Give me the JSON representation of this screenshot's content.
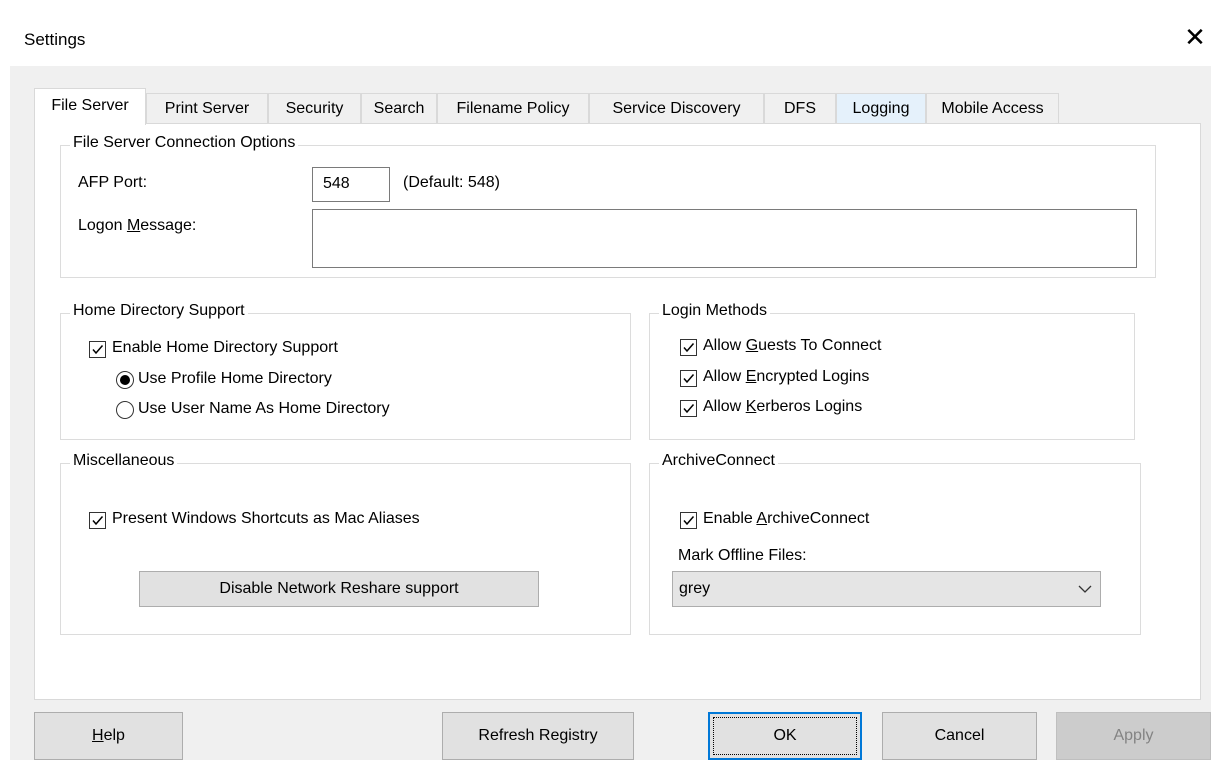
{
  "window": {
    "title": "Settings",
    "close_symbol": "✕"
  },
  "tabs": [
    {
      "label": "File Server",
      "active": true
    },
    {
      "label": "Print Server"
    },
    {
      "label": "Security"
    },
    {
      "label": "Search"
    },
    {
      "label": "Filename Policy"
    },
    {
      "label": "Service Discovery"
    },
    {
      "label": "DFS"
    },
    {
      "label": "Logging",
      "hover": true
    },
    {
      "label": "Mobile Access"
    }
  ],
  "connection": {
    "legend": "File Server Connection Options",
    "afp_port_label": "AFP Port:",
    "afp_port_value": "548",
    "afp_port_default": "(Default: 548)",
    "logon_message_label_pre": "Logon ",
    "logon_message_label_mn": "M",
    "logon_message_label_post": "essage:",
    "logon_message_value": ""
  },
  "home_dir": {
    "legend": "Home Directory Support",
    "enable_label": "Enable Home Directory Support",
    "enable_checked": true,
    "option_profile": "Use Profile Home Directory",
    "option_username": "Use User Name As Home Directory",
    "selected": "profile"
  },
  "login_methods": {
    "legend": "Login Methods",
    "guests_pre": "Allow ",
    "guests_mn": "G",
    "guests_post": "uests To Connect",
    "encrypted_pre": "Allow ",
    "encrypted_mn": "E",
    "encrypted_post": "ncrypted Logins",
    "kerberos_pre": "Allow ",
    "kerberos_mn": "K",
    "kerberos_post": "erberos Logins",
    "guests_checked": true,
    "encrypted_checked": true,
    "kerberos_checked": true
  },
  "misc": {
    "legend": "Miscellaneous",
    "shortcuts_label": "Present Windows Shortcuts as Mac Aliases",
    "shortcuts_checked": true,
    "reshare_button": "Disable Network Reshare support"
  },
  "archive": {
    "legend": "ArchiveConnect",
    "enable_pre": "Enable ",
    "enable_mn": "A",
    "enable_post": "rchiveConnect",
    "enable_checked": true,
    "mark_offline_label": "Mark Offline Files:",
    "mark_offline_value": "grey"
  },
  "buttons": {
    "help_mn": "H",
    "help_post": "elp",
    "refresh": "Refresh Registry",
    "ok": "OK",
    "cancel": "Cancel",
    "apply": "Apply"
  },
  "colors": {
    "accent": "#0078d7",
    "dialog_bg": "#f0f0f0",
    "border": "#dcdcdc"
  }
}
